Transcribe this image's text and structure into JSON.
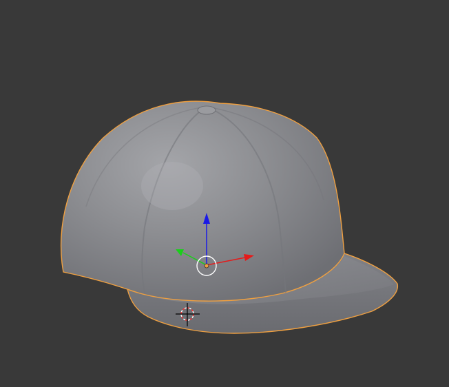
{
  "viewport": {
    "background_color": "#393939",
    "selected_object": "baseball-cap",
    "selection_outline_color": "#f0a040",
    "mesh_color": "#8a8b8f"
  },
  "gizmo": {
    "type": "translate",
    "axes": [
      {
        "axis": "z",
        "color": "#1a1ae6"
      },
      {
        "axis": "x",
        "color": "#e61a1a"
      },
      {
        "axis": "y",
        "color": "#1ad01a"
      }
    ],
    "center_ring_color": "#ffffff",
    "origin_color": "#f0a040"
  },
  "cursor_3d": {
    "ring_colors": [
      "#ff3030",
      "#ffffff"
    ]
  }
}
